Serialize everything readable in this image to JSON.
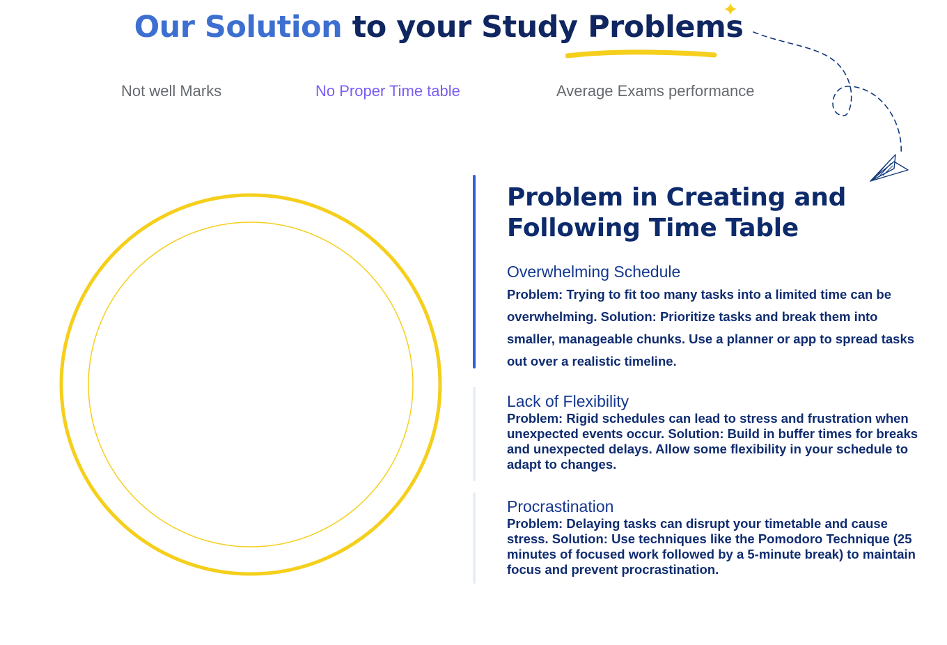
{
  "heading": {
    "accent": "Our Solution",
    "middle": "to your Study",
    "underlined": "Problems"
  },
  "tabs": [
    {
      "label": "Not well Marks",
      "active": false
    },
    {
      "label": "No Proper Time table",
      "active": true
    },
    {
      "label": "Average Exams performance",
      "active": false
    }
  ],
  "content": {
    "title": "Problem in Creating and Following Time Table",
    "items": [
      {
        "heading": "Overwhelming Schedule",
        "body": "Problem: Trying to fit too many tasks into a limited time can be overwhelming. Solution: Prioritize tasks and break them into smaller, manageable chunks. Use a planner or app to spread tasks out over a realistic timeline."
      },
      {
        "heading": "Lack of Flexibility",
        "body": "Problem: Rigid schedules can lead to stress and frustration when unexpected events occur. Solution: Build in buffer times for breaks and unexpected delays. Allow some flexibility in your schedule to adapt to changes."
      },
      {
        "heading": "Procrastination",
        "body": "Problem: Delaying tasks can disrupt your timetable and cause stress. Solution: Use techniques like the Pomodoro Technique (25 minutes of focused work followed by a 5-minute break) to maintain focus and prevent procrastination."
      }
    ]
  },
  "colors": {
    "accent_blue": "#3d6fd1",
    "navy": "#0f2660",
    "active_tab": "#7a5df2",
    "inactive_tab": "#666a70",
    "yellow": "#f5cf1c",
    "divider_active": "#3160d8",
    "divider_inactive": "#e7eef9"
  },
  "icons": [
    "star-sparkle-icon",
    "paper-plane-icon"
  ]
}
